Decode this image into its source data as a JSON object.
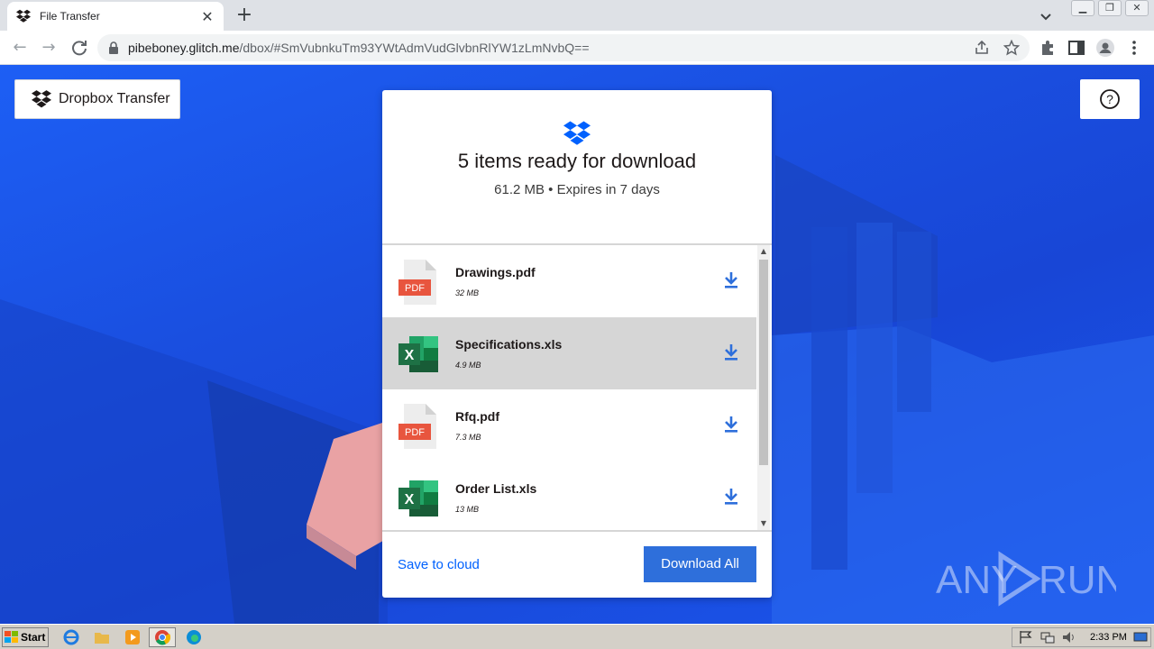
{
  "browser": {
    "tab_title": "File Transfer",
    "tab_close": "✕",
    "new_tab": "+",
    "url_host": "pibeboney.glitch.me",
    "url_path": "/dbox/#SmVubnkuTm93YWtAdmVudGlvbnRlYW1zLmNvbQ==",
    "window_controls": [
      "minimize",
      "restore",
      "close"
    ]
  },
  "header": {
    "brand_label": "Dropbox Transfer",
    "help_label": "?"
  },
  "transfer": {
    "title": "5 items ready for download",
    "subtitle": "61.2 MB • Expires in 7 days",
    "files": [
      {
        "name": "Drawings.pdf",
        "size": "32 MB",
        "type": "pdf",
        "badge": "PDF"
      },
      {
        "name": "Specifications.xls",
        "size": "4.9 MB",
        "type": "xls",
        "badge": "X"
      },
      {
        "name": "Rfq.pdf",
        "size": "7.3 MB",
        "type": "pdf",
        "badge": "PDF"
      },
      {
        "name": "Order List.xls",
        "size": "13 MB",
        "type": "xls",
        "badge": "X"
      }
    ],
    "save_label": "Save to cloud",
    "download_all_label": "Download All"
  },
  "watermark": {
    "text_left": "ANY",
    "text_right": "RUN"
  },
  "taskbar": {
    "start_label": "Start",
    "clock": "2:33 PM"
  },
  "colors": {
    "accent": "#0061fe",
    "button": "#2e6fdb",
    "pdf_red": "#e8553e",
    "excel_green": "#1e7145",
    "background_blue": "#1a4fe0"
  }
}
